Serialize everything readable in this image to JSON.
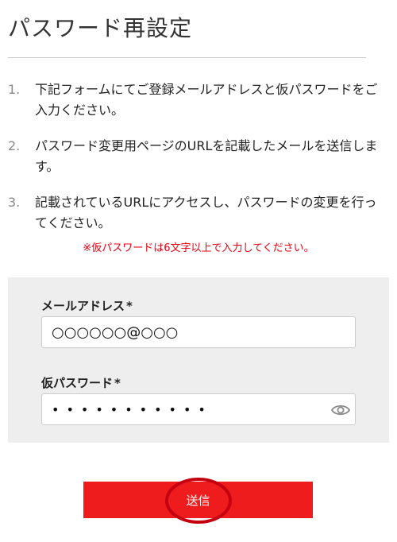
{
  "page": {
    "title": "パスワード再設定"
  },
  "steps": [
    {
      "number": "1.",
      "text": "下記フォームにてご登録メールアドレスと仮パスワードをご入力ください。"
    },
    {
      "number": "2.",
      "text": "パスワード変更用ページのURLを記載したメールを送信します。"
    },
    {
      "number": "3.",
      "text": "記載されているURLにアクセスし、パスワードの変更を行ってください。"
    }
  ],
  "note": "※仮パスワードは6文字以上で入力してください。",
  "form": {
    "email": {
      "label": "メールアドレス",
      "required_mark": "*",
      "value": "○○○○○○@○○○"
    },
    "password": {
      "label": "仮パスワード",
      "required_mark": "*",
      "value": "•••••••••••"
    }
  },
  "submit": {
    "label": "送信"
  },
  "colors": {
    "accent": "#ee1c1c",
    "note": "#e60012",
    "panel": "#eeeeee",
    "highlight_circle": "#c40010"
  }
}
